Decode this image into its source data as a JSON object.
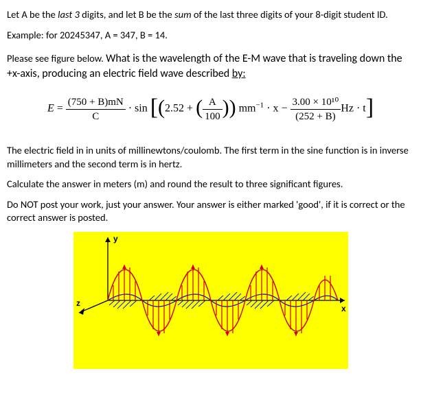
{
  "intro": {
    "line1_a": "Let A be the ",
    "line1_b": "last 3",
    "line1_c": " digits, and let B be the ",
    "line1_d": "sum",
    "line1_e": " of the last three digits of your 8-digit student ID.",
    "example": "Example: for 20245347, A = 347, B = 14."
  },
  "question": {
    "lead": "Please see figure below. ",
    "main1": "What is the wavelength of the E-M wave that is traveling down the +x-axis, producing an electric field wave described ",
    "by": "by:"
  },
  "eqn": {
    "E": "E",
    "eq": " = ",
    "frac1_num": "(750 + B)mN",
    "frac1_den": "C",
    "dot1": " · ",
    "sin": "sin",
    "k1": "2.52 + ",
    "frac2_num": "A",
    "frac2_den": "100",
    "unit_mm": " mm",
    "sup_minus1": "−1",
    "dotx": " · x − ",
    "frac3_num": "3.00 × 10¹⁰",
    "frac3_den": "(252 + B)",
    "hz": "Hz  · t"
  },
  "notes": {
    "p1": "The electric field in in units of millinewtons/coulomb. The first term in the sine function is in inverse millimeters and the second term is in hertz.",
    "p2": " Calculate the answer in meters (m) and round the result to three significant figures.",
    "p3": "Do NOT post your work, just your answer. Your answer is either marked 'good', if it is correct or the correct answer is posted."
  },
  "axes": {
    "y": "y",
    "z": "z",
    "x": "x"
  }
}
